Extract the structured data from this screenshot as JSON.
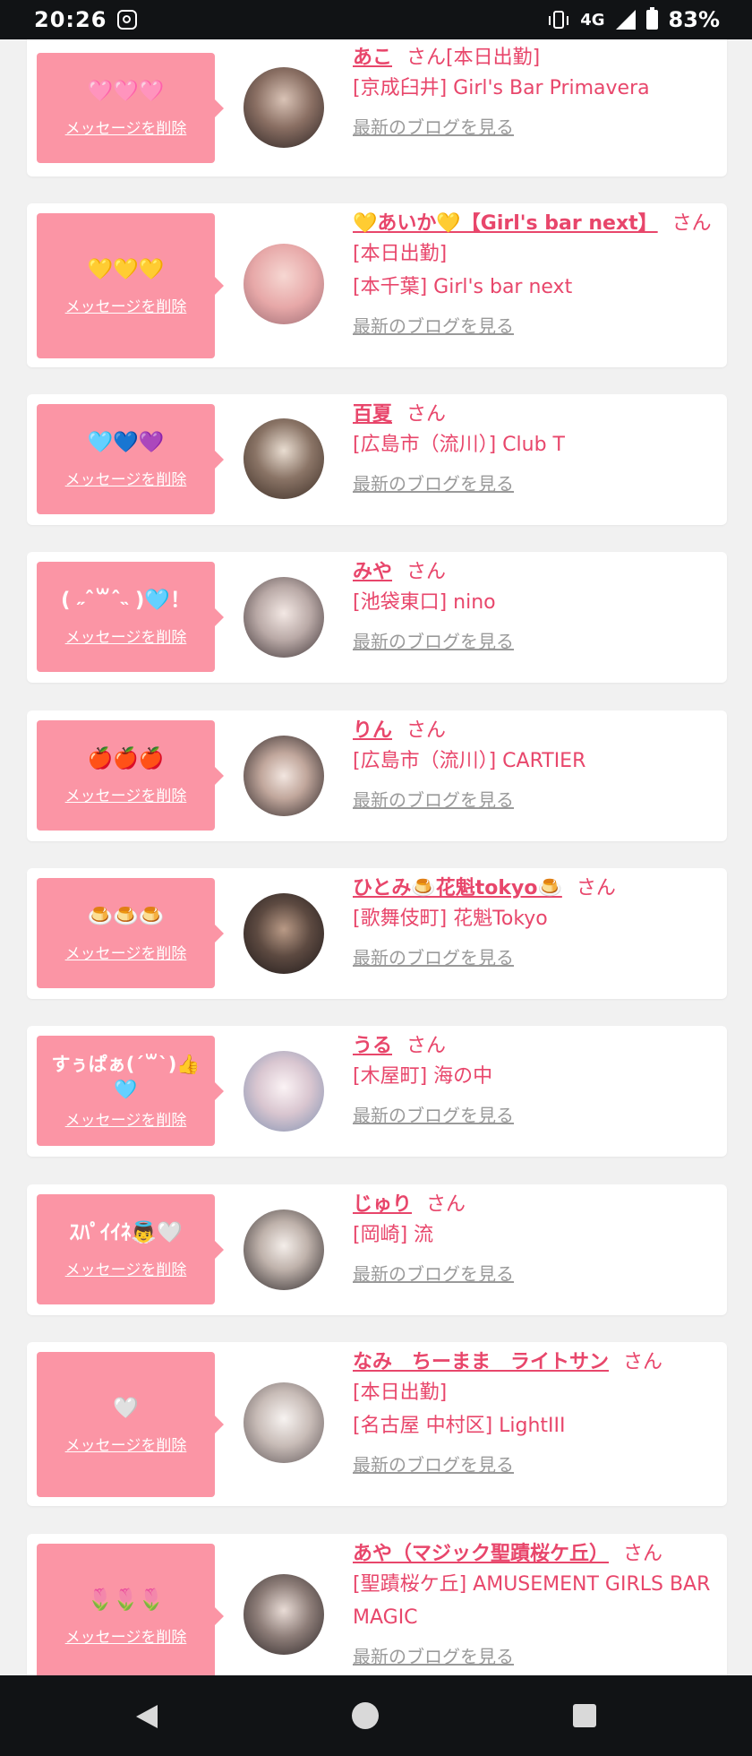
{
  "status_bar": {
    "time": "20:26",
    "network": "4G",
    "battery": "83%"
  },
  "delete_label": "メッセージを削除",
  "blog_label": "最新のブログを見る",
  "colors": {
    "accent": "#e8466b",
    "message_box": "#fb95a5",
    "muted_link": "#9a9a9a"
  },
  "entries": [
    {
      "message": "🩷🩷🩷",
      "name": "あこ",
      "suffix": "さん[本日出勤]",
      "lines": [
        "[京成臼井] Girl's Bar Primavera"
      ]
    },
    {
      "message": "💛💛💛",
      "name": "💛あいか💛【Girl's bar next】",
      "suffix": "さん",
      "lines": [
        "[本日出勤]",
        "[本千葉] Girl's bar next"
      ]
    },
    {
      "message": "🩵💙💜",
      "name": "百夏",
      "suffix": "さん",
      "lines": [
        "[広島市（流川）] Club T"
      ]
    },
    {
      "message": "( ˶ˆ꒳ˆ˵ )🩵！",
      "name": "みや",
      "suffix": "さん",
      "lines": [
        "[池袋東口] nino"
      ]
    },
    {
      "message": "🍎🍎🍎",
      "name": "りん",
      "suffix": "さん",
      "lines": [
        "[広島市（流川）] CARTIER"
      ]
    },
    {
      "message": "🍮🍮🍮",
      "name": "ひとみ🍮花魁tokyo🍮",
      "suffix": "さん",
      "lines": [
        "[歌舞伎町] 花魁Tokyo"
      ]
    },
    {
      "message": "すぅぱぁ(ˊ꒳ˋ)👍🩵",
      "name": "うる",
      "suffix": "さん",
      "lines": [
        "[木屋町] 海の中"
      ]
    },
    {
      "message": "ｽﾊﾟｲｲﾈ👼🤍",
      "name": "じゅり",
      "suffix": "さん",
      "lines": [
        "[岡崎] 流"
      ]
    },
    {
      "message": "🤍",
      "name": "なみ　ちーまま　ライトサン",
      "suffix": "さん",
      "lines": [
        "[本日出勤]",
        "[名古屋 中村区] LightIII"
      ]
    },
    {
      "message": "🌷🌷🌷",
      "name": "あや（マジック聖蹟桜ケ丘）",
      "suffix": "さん",
      "lines": [
        "[聖蹟桜ケ丘] AMUSEMENT GIRLS BAR MAGIC"
      ]
    }
  ]
}
